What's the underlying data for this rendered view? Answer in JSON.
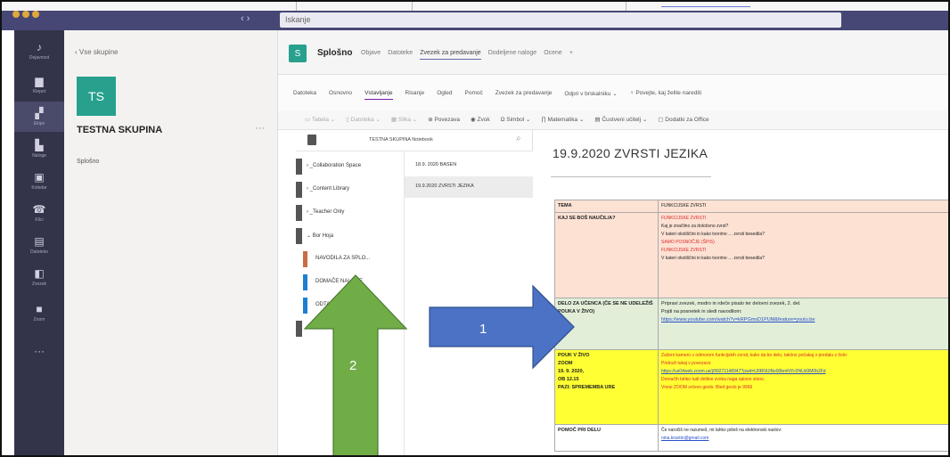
{
  "titlebar": {
    "nav": "‹ ›",
    "search_placeholder": "Iskanje"
  },
  "rail": {
    "items": [
      {
        "icon": "bell-icon",
        "glyph": "♪",
        "label": "Dejavnost"
      },
      {
        "icon": "chat-icon",
        "glyph": "▆",
        "label": "Klepet"
      },
      {
        "icon": "teams-icon",
        "glyph": "▞",
        "label": "Ekipe"
      },
      {
        "icon": "assignments-icon",
        "glyph": "▙",
        "label": "Naloge"
      },
      {
        "icon": "calendar-icon",
        "glyph": "▣",
        "label": "Koledar"
      },
      {
        "icon": "calls-icon",
        "glyph": "☎",
        "label": "Klici"
      },
      {
        "icon": "files-icon",
        "glyph": "▤",
        "label": "Datoteke"
      },
      {
        "icon": "class-notebook-icon",
        "glyph": "◧",
        "label": "Zvezek"
      },
      {
        "icon": "video-icon",
        "glyph": "■",
        "label": "Zoom"
      },
      {
        "icon": "more-icon",
        "glyph": "···",
        "label": ""
      }
    ]
  },
  "sidebar": {
    "back_label": "‹ Vse skupine",
    "avatar_text": "TS",
    "team_name": "TESTNA SKUPINA",
    "more": "···",
    "channel": "Splošno"
  },
  "channel": {
    "icon_text": "S",
    "name": "Splošno",
    "tabs": [
      "Objave",
      "Datoteke",
      "Zvezek za predavanje",
      "Dodeljene naloge",
      "Ocene",
      "+"
    ],
    "active_tab": 2
  },
  "onenote": {
    "tabs": [
      "Datoteka",
      "Osnovno",
      "Vstavljanje",
      "Risanje",
      "Ogled",
      "Pomoč",
      "Zvezek za predavanje",
      "Odpri v brskalniku ⌄",
      "♀ Povejte, kaj želite narediti"
    ],
    "active_tab": 2,
    "ribbon": [
      "▭ Tabela ⌄",
      "▯ Datoteka ⌄",
      "▦ Slika ⌄",
      "⊕ Povezava",
      "◉ Zvok",
      "Ω Simbol ⌄",
      "∏ Matematika ⌄",
      "▤ Čustveni učitelj ⌄",
      "▢ Dodatki za Office"
    ],
    "notebook_title": "TESTNA SKUPINA Notebook",
    "sections": [
      {
        "label": "› _Collaboration Space",
        "color": "#555555"
      },
      {
        "label": "› _Content Library",
        "color": "#555555"
      },
      {
        "label": "› _Teacher Only",
        "color": "#555555"
      },
      {
        "label": "⌄ Bor Hoja",
        "color": "#555555"
      },
      {
        "label": "NAVODILA ZA SPLO...",
        "color": "#c96b44"
      },
      {
        "label": "DOMAČE NALOGE",
        "color": "#1b7fd1"
      },
      {
        "label": "ODTA...",
        "color": "#1b7fd1"
      },
      {
        "label": "› K...",
        "color": "#555555"
      }
    ],
    "pages": [
      "18.9. 2020 BASEN",
      "19.9.2020 ZVRSTI JEZIKA"
    ],
    "selected_page": 1,
    "page_title": "19.9.2020 ZVRSTI JEZIKA"
  },
  "lesson": {
    "tema_label": "TEMA",
    "tema_value": "FUNKCIJSKE ZVRSTI",
    "learn_label": "KAJ SE BOŠ NAUČIL/A?",
    "learn_lines": [
      "FUNKCIJSKE ZVRSTI",
      "Kaj je značilno za določeno zvrst?",
      "V kateri okoliščini in kako tvorimo … zvrsti besedila?",
      "SAMO POSNOČJE (ŠPIS)",
      "FUNKCIJSKE ZVRSTI",
      "V kateri okoliščini in kako tvorimo … zvrsti besedila?"
    ],
    "work_label": "DELO ZA UČENCA (ČE SE NE UDELEŽIŠ POUKA V ŽIVO)",
    "work_line1": "Pripravi zvezek, modro in rdeče pisalo ter delovni zvezek, 2. del.",
    "work_line2": "Pojdi na posnetek in sledi navodilom:",
    "work_link": "https://www.youtube.com/watch?v=kRPGmxD1PUM&feature=youtu.be",
    "live_label_lines": [
      "POUK V ŽIVO",
      "ZOOM",
      "19. 9. 2020,",
      "OB 12.15",
      "PAZI: SPREMEMBA URE"
    ],
    "live_lines": [
      "Zaženi kamero v odmorom funkcijskih zvrsti, kako da bo delo, takšno počakaj v predalu s šolo:",
      "Pridruži tukaj v povezavo"
    ],
    "live_link": "https://us04web.zoom.us/j/99271148947?pwd=U0RNUlNx00bmNYc0NUd3M0b2Fd",
    "live_warn1": "Domačih lahko tudi delitve zvoka naga opisno sinoo.",
    "live_warn2": "Vnesi ZOOM srčevo geslo. Bled geslo je 9966",
    "help_label": "POMOČ PRI DELU",
    "help_line": "Če naročiš ne razumeš, mi lahko pišeš na elektronski naslov:",
    "help_email": "nina.kravtin@gmail.com"
  },
  "annotations": {
    "arrow1_label": "1",
    "arrow1_color": "#4b72c4",
    "arrow2_label": "2",
    "arrow2_color": "#70ad47"
  }
}
